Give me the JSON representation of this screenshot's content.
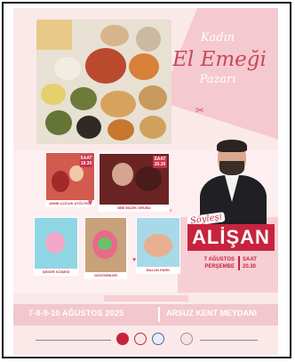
{
  "poster": {
    "title_line1": "Kadın",
    "title_line2": "El Emeği",
    "title_line3": "Pazarı",
    "soylesi": "Söyleşi",
    "artist_name": "ALİŞAN",
    "concert_date_day": "7 AĞUSTOS",
    "concert_date_weekday": "PERŞEMBE",
    "concert_time_label": "SAAT",
    "concert_time": "20.30",
    "footer_dates": "7-8-9-10 AĞUSTOS 2025",
    "footer_place": "ARSUZ KENT MEYDANI"
  },
  "events": [
    {
      "tag": "SAAT 19.30",
      "caption": "ANNE-ÇOCUK ATÖLYESİ"
    },
    {
      "tag": "SAAT 20.30",
      "caption": "NİBİ MÜZİK GRUBU"
    },
    {
      "tag": "",
      "caption": "ŞEKER KÖŞESİ"
    },
    {
      "tag": "",
      "caption": "GÖSTERİLER"
    },
    {
      "tag": "",
      "caption": "BALON PARK"
    }
  ],
  "colors": {
    "accent": "#c8233e",
    "pink": "#f4c9cf",
    "background": "#fbe9ea"
  }
}
